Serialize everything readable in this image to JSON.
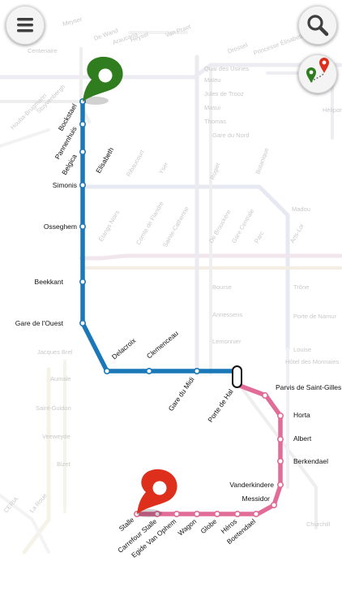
{
  "controls": {
    "menu_icon": "hamburger-menu-icon",
    "search_icon": "magnifier-icon",
    "route_icon": "route-pins-icon"
  },
  "colors": {
    "line_blue": "#1a78b8",
    "line_pink": "#e06c97",
    "pin_origin": "#2f7d1f",
    "pin_destination": "#dd2f1b",
    "ghost_lines": "#e8e8ee"
  },
  "route": {
    "origin": "Bockstael",
    "destination": "Stalle",
    "blue_segment": [
      "Bockstael",
      "Pannenhuis",
      "Belgica",
      "Elisabeth",
      "Simonis",
      "Osseghem",
      "Beekkant",
      "Gare de l'Ouest",
      "Delacroix",
      "Clemenceau",
      "Gare du Midi",
      "Porte de Hal"
    ],
    "pink_segment": [
      "Porte de Hal",
      "Parvis de Saint-Gilles",
      "Horta",
      "Albert",
      "Berkendael",
      "Vanderkindere",
      "Messidor",
      "Boetendael",
      "Héros",
      "Globe",
      "Wagon",
      "Egide Van Ophem",
      "Carrefour Stalle",
      "Stalle"
    ]
  },
  "stations": {
    "bockstael": "Bockstael",
    "pannenhuis": "Pannenhuis",
    "belgica": "Belgica",
    "elisabeth": "Elisabeth",
    "simonis": "Simonis",
    "osseghem": "Osseghem",
    "beekkant": "Beekkant",
    "gare_ouest": "Gare de l'Ouest",
    "delacroix": "Delacroix",
    "clemenceau": "Clemenceau",
    "gare_midi": "Gare du Midi",
    "porte_hal": "Porte de Hal",
    "parvis": "Parvis de Saint-Gilles",
    "horta": "Horta",
    "albert": "Albert",
    "berkendael": "Berkendael",
    "vanderkindere": "Vanderkindere",
    "messidor": "Messidor",
    "boetendael": "Boetendael",
    "heros": "Héros",
    "globe": "Globe",
    "wagon": "Wagon",
    "egide": "Egide Van Ophem",
    "carrefour": "Carrefour Stalle",
    "stalle": "Stalle"
  },
  "background_labels": {
    "centenaire": "Centenaire",
    "de_wand": "De Wand",
    "araucaria": "Araucaria",
    "heysel": "Heysel",
    "meyser": "Meyser",
    "van_praet": "Van Praet",
    "rogier": "Rogier",
    "houba": "Houba-Brugmann",
    "stuyvenbergh": "Stuyvenbergh",
    "quai_usines": "Quai des Usines",
    "maleu": "Maleu",
    "jules_trooz": "Jules de Trooz",
    "masui": "Masui",
    "thomas": "Thomas",
    "gare_nord": "Gare du Nord",
    "botanique": "Botanique",
    "madou": "Madou",
    "arts_loi": "Arts-Loi",
    "bourse": "Bourse",
    "treone": "Trône",
    "annessens": "Annessens",
    "porte_namur": "Porte de Namur",
    "lemonnier": "Lemonnier",
    "louise": "Louise",
    "hotel_monnaies": "Hôtel des Monnaies",
    "jacques_brel": "Jacques Brel",
    "aumale": "Aumale",
    "saint_guidon": "Saint-Guidon",
    "veeweyde": "Veeweyde",
    "bizet": "Bizet",
    "ceria": "CERIA",
    "la_roue": "La Roue",
    "churchill": "Churchill",
    "etangs_noirs": "Étangs Noirs",
    "comte_flandre": "Comte de Flandre",
    "sainte_catherine": "Sainte-Catherine",
    "de_brouckere": "De Brouckère",
    "gare_centrale": "Gare Centrale",
    "parc": "Parc",
    "yser": "Yser",
    "ribaucourt": "Ribaucourt",
    "helios": "Héliport",
    "princesse": "Princesse Élisabeth",
    "drossel": "Drossel",
    "belgica_g": "Belgica"
  }
}
